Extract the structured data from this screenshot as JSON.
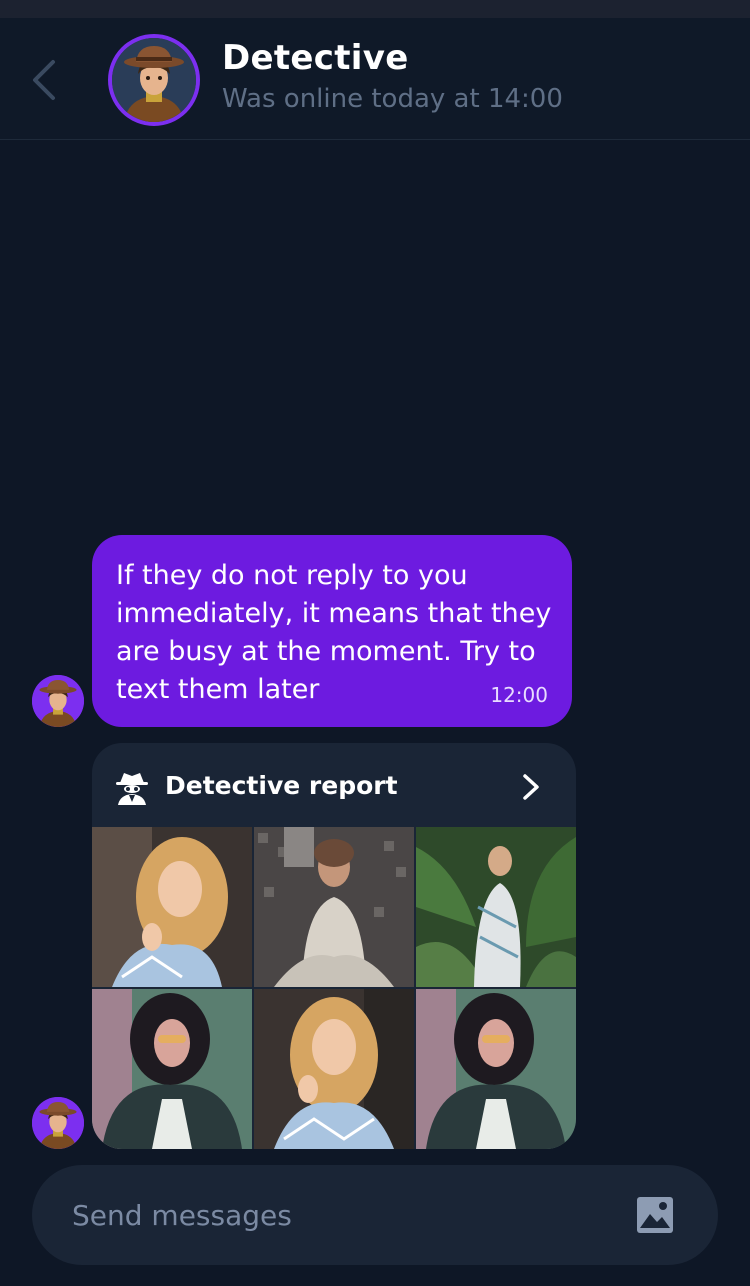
{
  "header": {
    "title": "Detective",
    "status": "Was online today at 14:00"
  },
  "messages": [
    {
      "text": "If they do not reply to you immediately, it means that they are busy at the moment. Try to text them later",
      "time": "12:00"
    }
  ],
  "report": {
    "title": "Detective report",
    "icon": "spy-icon",
    "photos": [
      "blonde-woman-photo",
      "woman-sequin-dress-photo",
      "woman-palm-leaves-photo",
      "woman-denim-jacket-photo",
      "blonde-woman-photo",
      "woman-denim-jacket-photo"
    ]
  },
  "composer": {
    "placeholder": "Send messages",
    "attach_icon": "image-icon"
  },
  "colors": {
    "background": "#0e1726",
    "accent": "#6d1be0",
    "card": "#1a2536",
    "muted_text": "#5f6f86"
  }
}
